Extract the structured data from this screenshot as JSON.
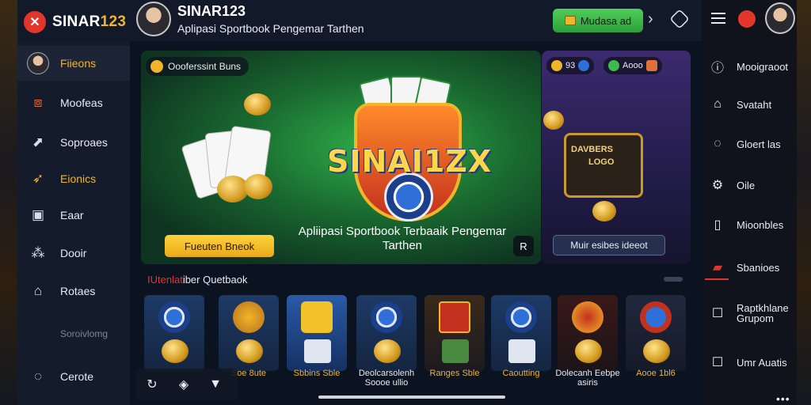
{
  "header": {
    "brand": "SINAR",
    "brand_num": "123",
    "title": "SINAR123",
    "subtitle": "Aplipasi Sportbook Pengemar Tarthen",
    "green_button": "Mudasa ad",
    "accent": "#e2362c",
    "gold": "#f1b52a",
    "green": "#3fb84c"
  },
  "sidebar": {
    "items": [
      {
        "label": "Fiieons",
        "icon": "avatar"
      },
      {
        "label": "Moofeas",
        "icon": "box-icon"
      },
      {
        "label": "Soproaes",
        "icon": "chart-icon"
      },
      {
        "label": "Eionics",
        "icon": "bolt-icon"
      },
      {
        "label": "Eaar",
        "icon": "monitor-icon"
      },
      {
        "label": "Dooir",
        "icon": "ticket-icon"
      },
      {
        "label": "Rotaes",
        "icon": "home-icon"
      },
      {
        "label": "Soroivlomg",
        "icon": ""
      },
      {
        "label": "Cerote",
        "icon": "chat-icon"
      }
    ]
  },
  "hero": {
    "tag": "Oooferssint Buns",
    "logo_text": "SINAI1ZX",
    "cta": "Fueuten Bneok",
    "caption": "Apliipasi Sportbook Terbaaik Pengemar Tarthen"
  },
  "panel": {
    "pill1": "93",
    "pill2": "Aooo",
    "frame_text": "DAVBERS",
    "frame_sub": "LOGO",
    "button": "Muir esibes ideeot"
  },
  "games": {
    "title_red": "IUtenlat",
    "title_rest": "iber Quetbaok",
    "tiles": [
      {
        "label": ""
      },
      {
        "label": "Soe 8ute"
      },
      {
        "label": "Sbbins Sble"
      },
      {
        "label": "Deolcarsolenh Soooe ullio"
      },
      {
        "label": "Ranges Sble"
      },
      {
        "label": "Caoutting"
      },
      {
        "label": "Dolecanh Eebpe asiris"
      },
      {
        "label": "Aooe 1bl6"
      }
    ]
  },
  "right_sidebar": {
    "items": [
      {
        "label": "Mooigraoot",
        "icon": "info-icon"
      },
      {
        "label": "Svataht",
        "icon": "home-icon"
      },
      {
        "label": "Gloert las",
        "icon": "chat-icon"
      },
      {
        "label": "Oile",
        "icon": "gear-icon"
      },
      {
        "label": "Mioonbles",
        "icon": "info-icon"
      },
      {
        "label": "Sbanioes",
        "icon": "wallet-icon"
      },
      {
        "label": "Raptkhlane",
        "sub": "Grupom",
        "icon": "list-icon"
      },
      {
        "label": "Umr Auatis",
        "icon": "list-icon"
      }
    ]
  }
}
